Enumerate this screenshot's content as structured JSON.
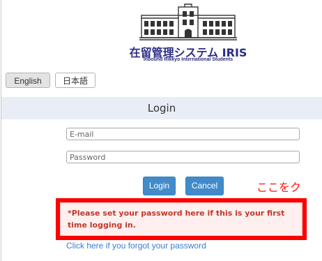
{
  "header": {
    "title": "在留管理システム IRIS",
    "subtitle": "Inbound Rikkyo International Students"
  },
  "language": {
    "english_label": "English",
    "japanese_label": "日本語"
  },
  "login": {
    "heading": "Login",
    "email_placeholder": "E-mail",
    "password_placeholder": "Password",
    "login_button": "Login",
    "cancel_button": "Cancel",
    "notice": "*Please set your password here if this is your first time logging in.",
    "forgot_link": "Click here if you forgot your password"
  },
  "annotation": {
    "callout_text": "ここをク"
  },
  "colors": {
    "brand": "#2b2d86",
    "accent": "#428bca",
    "warning": "#c0392b",
    "highlight_frame": "#ff0000"
  }
}
